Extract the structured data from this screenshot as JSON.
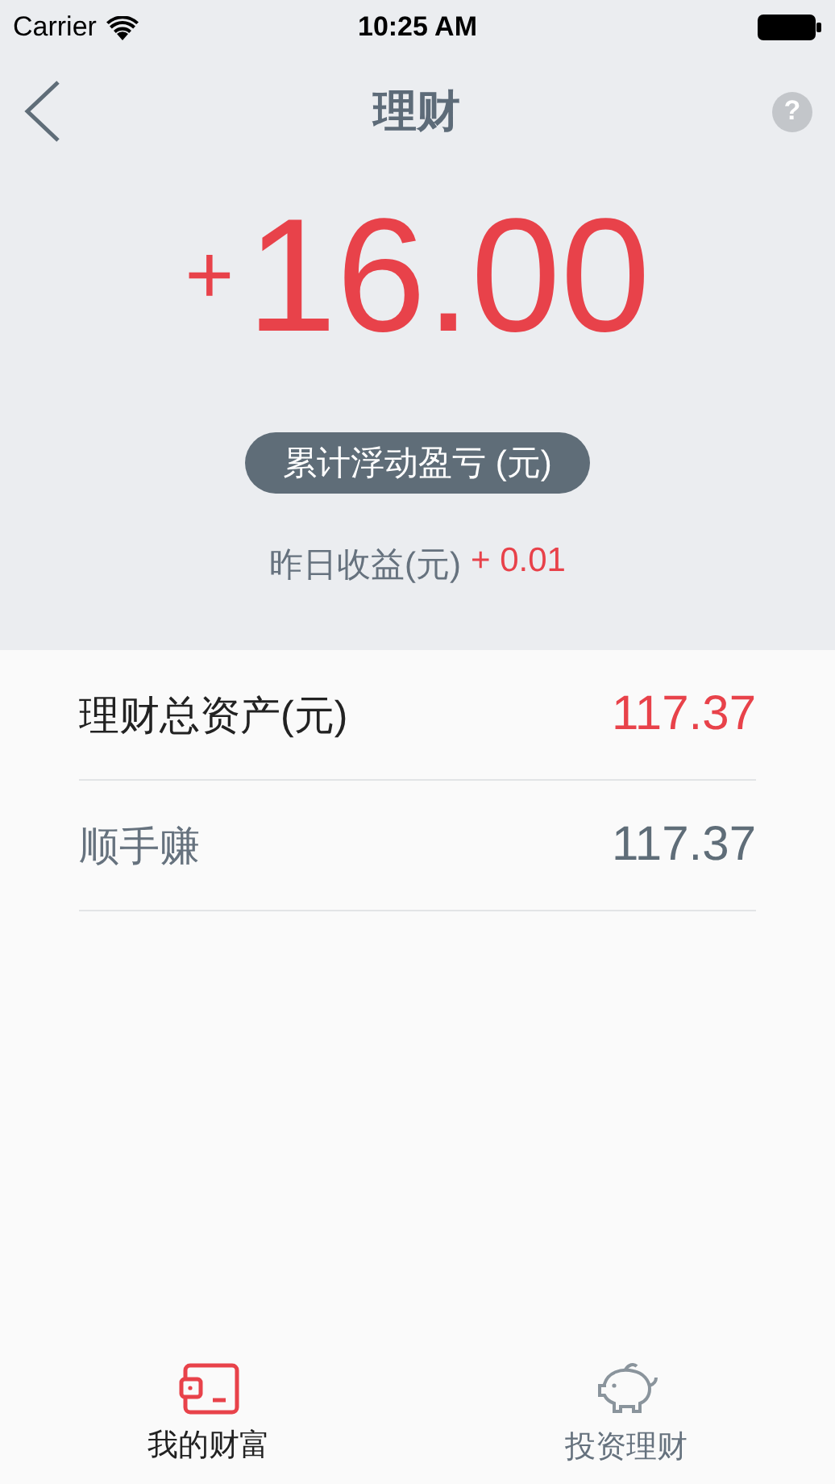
{
  "status_bar": {
    "carrier": "Carrier",
    "time": "10:25 AM"
  },
  "nav": {
    "title": "理财",
    "help_icon_text": "?"
  },
  "summary": {
    "sign": "+",
    "amount": "16.00",
    "badge": "累计浮动盈亏 (元)",
    "yesterday_label": "昨日收益(元)",
    "yesterday_value": "+ 0.01"
  },
  "rows": [
    {
      "label": "理财总资产(元)",
      "value": "117.37",
      "highlight": true
    },
    {
      "label": "顺手赚",
      "value": "117.37",
      "highlight": false
    }
  ],
  "tabs": [
    {
      "label": "我的财富",
      "kind": "wallet",
      "selected": true
    },
    {
      "label": "投资理财",
      "kind": "piggy",
      "selected": false
    }
  ]
}
